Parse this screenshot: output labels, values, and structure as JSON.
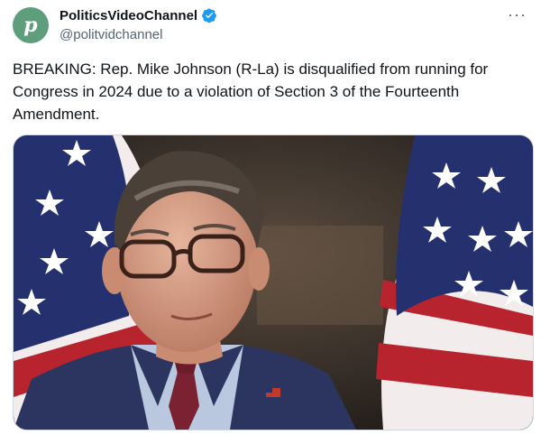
{
  "author": {
    "avatar_letter": "p",
    "avatar_color": "#5f9e7c",
    "display_name": "PoliticsVideoChannel",
    "handle": "@politvidchannel",
    "verified": true,
    "verified_color": "#1d9bf0"
  },
  "more_label": "···",
  "tweet": {
    "text": "BREAKING: Rep. Mike Johnson (R-La) is disqualified from running for Congress in 2024 due to a violation of Section 3 of the Fourteenth Amendment."
  },
  "media": {
    "icons": [
      "flag-left",
      "flag-right"
    ],
    "colors": {
      "flag_blue": "#25306e",
      "flag_red": "#b8242e",
      "suit": "#2c3560",
      "shirt": "#b9c8de",
      "tie": "#7b2232"
    }
  }
}
